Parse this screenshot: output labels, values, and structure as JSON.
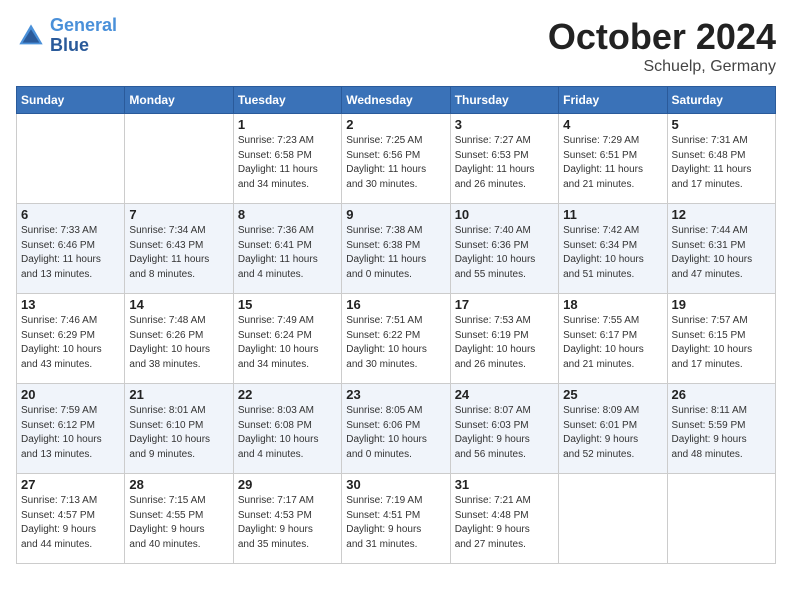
{
  "header": {
    "logo_line1": "General",
    "logo_line2": "Blue",
    "month": "October 2024",
    "location": "Schuelp, Germany"
  },
  "weekdays": [
    "Sunday",
    "Monday",
    "Tuesday",
    "Wednesday",
    "Thursday",
    "Friday",
    "Saturday"
  ],
  "weeks": [
    [
      {
        "day": "",
        "info": ""
      },
      {
        "day": "",
        "info": ""
      },
      {
        "day": "1",
        "info": "Sunrise: 7:23 AM\nSunset: 6:58 PM\nDaylight: 11 hours\nand 34 minutes."
      },
      {
        "day": "2",
        "info": "Sunrise: 7:25 AM\nSunset: 6:56 PM\nDaylight: 11 hours\nand 30 minutes."
      },
      {
        "day": "3",
        "info": "Sunrise: 7:27 AM\nSunset: 6:53 PM\nDaylight: 11 hours\nand 26 minutes."
      },
      {
        "day": "4",
        "info": "Sunrise: 7:29 AM\nSunset: 6:51 PM\nDaylight: 11 hours\nand 21 minutes."
      },
      {
        "day": "5",
        "info": "Sunrise: 7:31 AM\nSunset: 6:48 PM\nDaylight: 11 hours\nand 17 minutes."
      }
    ],
    [
      {
        "day": "6",
        "info": "Sunrise: 7:33 AM\nSunset: 6:46 PM\nDaylight: 11 hours\nand 13 minutes."
      },
      {
        "day": "7",
        "info": "Sunrise: 7:34 AM\nSunset: 6:43 PM\nDaylight: 11 hours\nand 8 minutes."
      },
      {
        "day": "8",
        "info": "Sunrise: 7:36 AM\nSunset: 6:41 PM\nDaylight: 11 hours\nand 4 minutes."
      },
      {
        "day": "9",
        "info": "Sunrise: 7:38 AM\nSunset: 6:38 PM\nDaylight: 11 hours\nand 0 minutes."
      },
      {
        "day": "10",
        "info": "Sunrise: 7:40 AM\nSunset: 6:36 PM\nDaylight: 10 hours\nand 55 minutes."
      },
      {
        "day": "11",
        "info": "Sunrise: 7:42 AM\nSunset: 6:34 PM\nDaylight: 10 hours\nand 51 minutes."
      },
      {
        "day": "12",
        "info": "Sunrise: 7:44 AM\nSunset: 6:31 PM\nDaylight: 10 hours\nand 47 minutes."
      }
    ],
    [
      {
        "day": "13",
        "info": "Sunrise: 7:46 AM\nSunset: 6:29 PM\nDaylight: 10 hours\nand 43 minutes."
      },
      {
        "day": "14",
        "info": "Sunrise: 7:48 AM\nSunset: 6:26 PM\nDaylight: 10 hours\nand 38 minutes."
      },
      {
        "day": "15",
        "info": "Sunrise: 7:49 AM\nSunset: 6:24 PM\nDaylight: 10 hours\nand 34 minutes."
      },
      {
        "day": "16",
        "info": "Sunrise: 7:51 AM\nSunset: 6:22 PM\nDaylight: 10 hours\nand 30 minutes."
      },
      {
        "day": "17",
        "info": "Sunrise: 7:53 AM\nSunset: 6:19 PM\nDaylight: 10 hours\nand 26 minutes."
      },
      {
        "day": "18",
        "info": "Sunrise: 7:55 AM\nSunset: 6:17 PM\nDaylight: 10 hours\nand 21 minutes."
      },
      {
        "day": "19",
        "info": "Sunrise: 7:57 AM\nSunset: 6:15 PM\nDaylight: 10 hours\nand 17 minutes."
      }
    ],
    [
      {
        "day": "20",
        "info": "Sunrise: 7:59 AM\nSunset: 6:12 PM\nDaylight: 10 hours\nand 13 minutes."
      },
      {
        "day": "21",
        "info": "Sunrise: 8:01 AM\nSunset: 6:10 PM\nDaylight: 10 hours\nand 9 minutes."
      },
      {
        "day": "22",
        "info": "Sunrise: 8:03 AM\nSunset: 6:08 PM\nDaylight: 10 hours\nand 4 minutes."
      },
      {
        "day": "23",
        "info": "Sunrise: 8:05 AM\nSunset: 6:06 PM\nDaylight: 10 hours\nand 0 minutes."
      },
      {
        "day": "24",
        "info": "Sunrise: 8:07 AM\nSunset: 6:03 PM\nDaylight: 9 hours\nand 56 minutes."
      },
      {
        "day": "25",
        "info": "Sunrise: 8:09 AM\nSunset: 6:01 PM\nDaylight: 9 hours\nand 52 minutes."
      },
      {
        "day": "26",
        "info": "Sunrise: 8:11 AM\nSunset: 5:59 PM\nDaylight: 9 hours\nand 48 minutes."
      }
    ],
    [
      {
        "day": "27",
        "info": "Sunrise: 7:13 AM\nSunset: 4:57 PM\nDaylight: 9 hours\nand 44 minutes."
      },
      {
        "day": "28",
        "info": "Sunrise: 7:15 AM\nSunset: 4:55 PM\nDaylight: 9 hours\nand 40 minutes."
      },
      {
        "day": "29",
        "info": "Sunrise: 7:17 AM\nSunset: 4:53 PM\nDaylight: 9 hours\nand 35 minutes."
      },
      {
        "day": "30",
        "info": "Sunrise: 7:19 AM\nSunset: 4:51 PM\nDaylight: 9 hours\nand 31 minutes."
      },
      {
        "day": "31",
        "info": "Sunrise: 7:21 AM\nSunset: 4:48 PM\nDaylight: 9 hours\nand 27 minutes."
      },
      {
        "day": "",
        "info": ""
      },
      {
        "day": "",
        "info": ""
      }
    ]
  ]
}
